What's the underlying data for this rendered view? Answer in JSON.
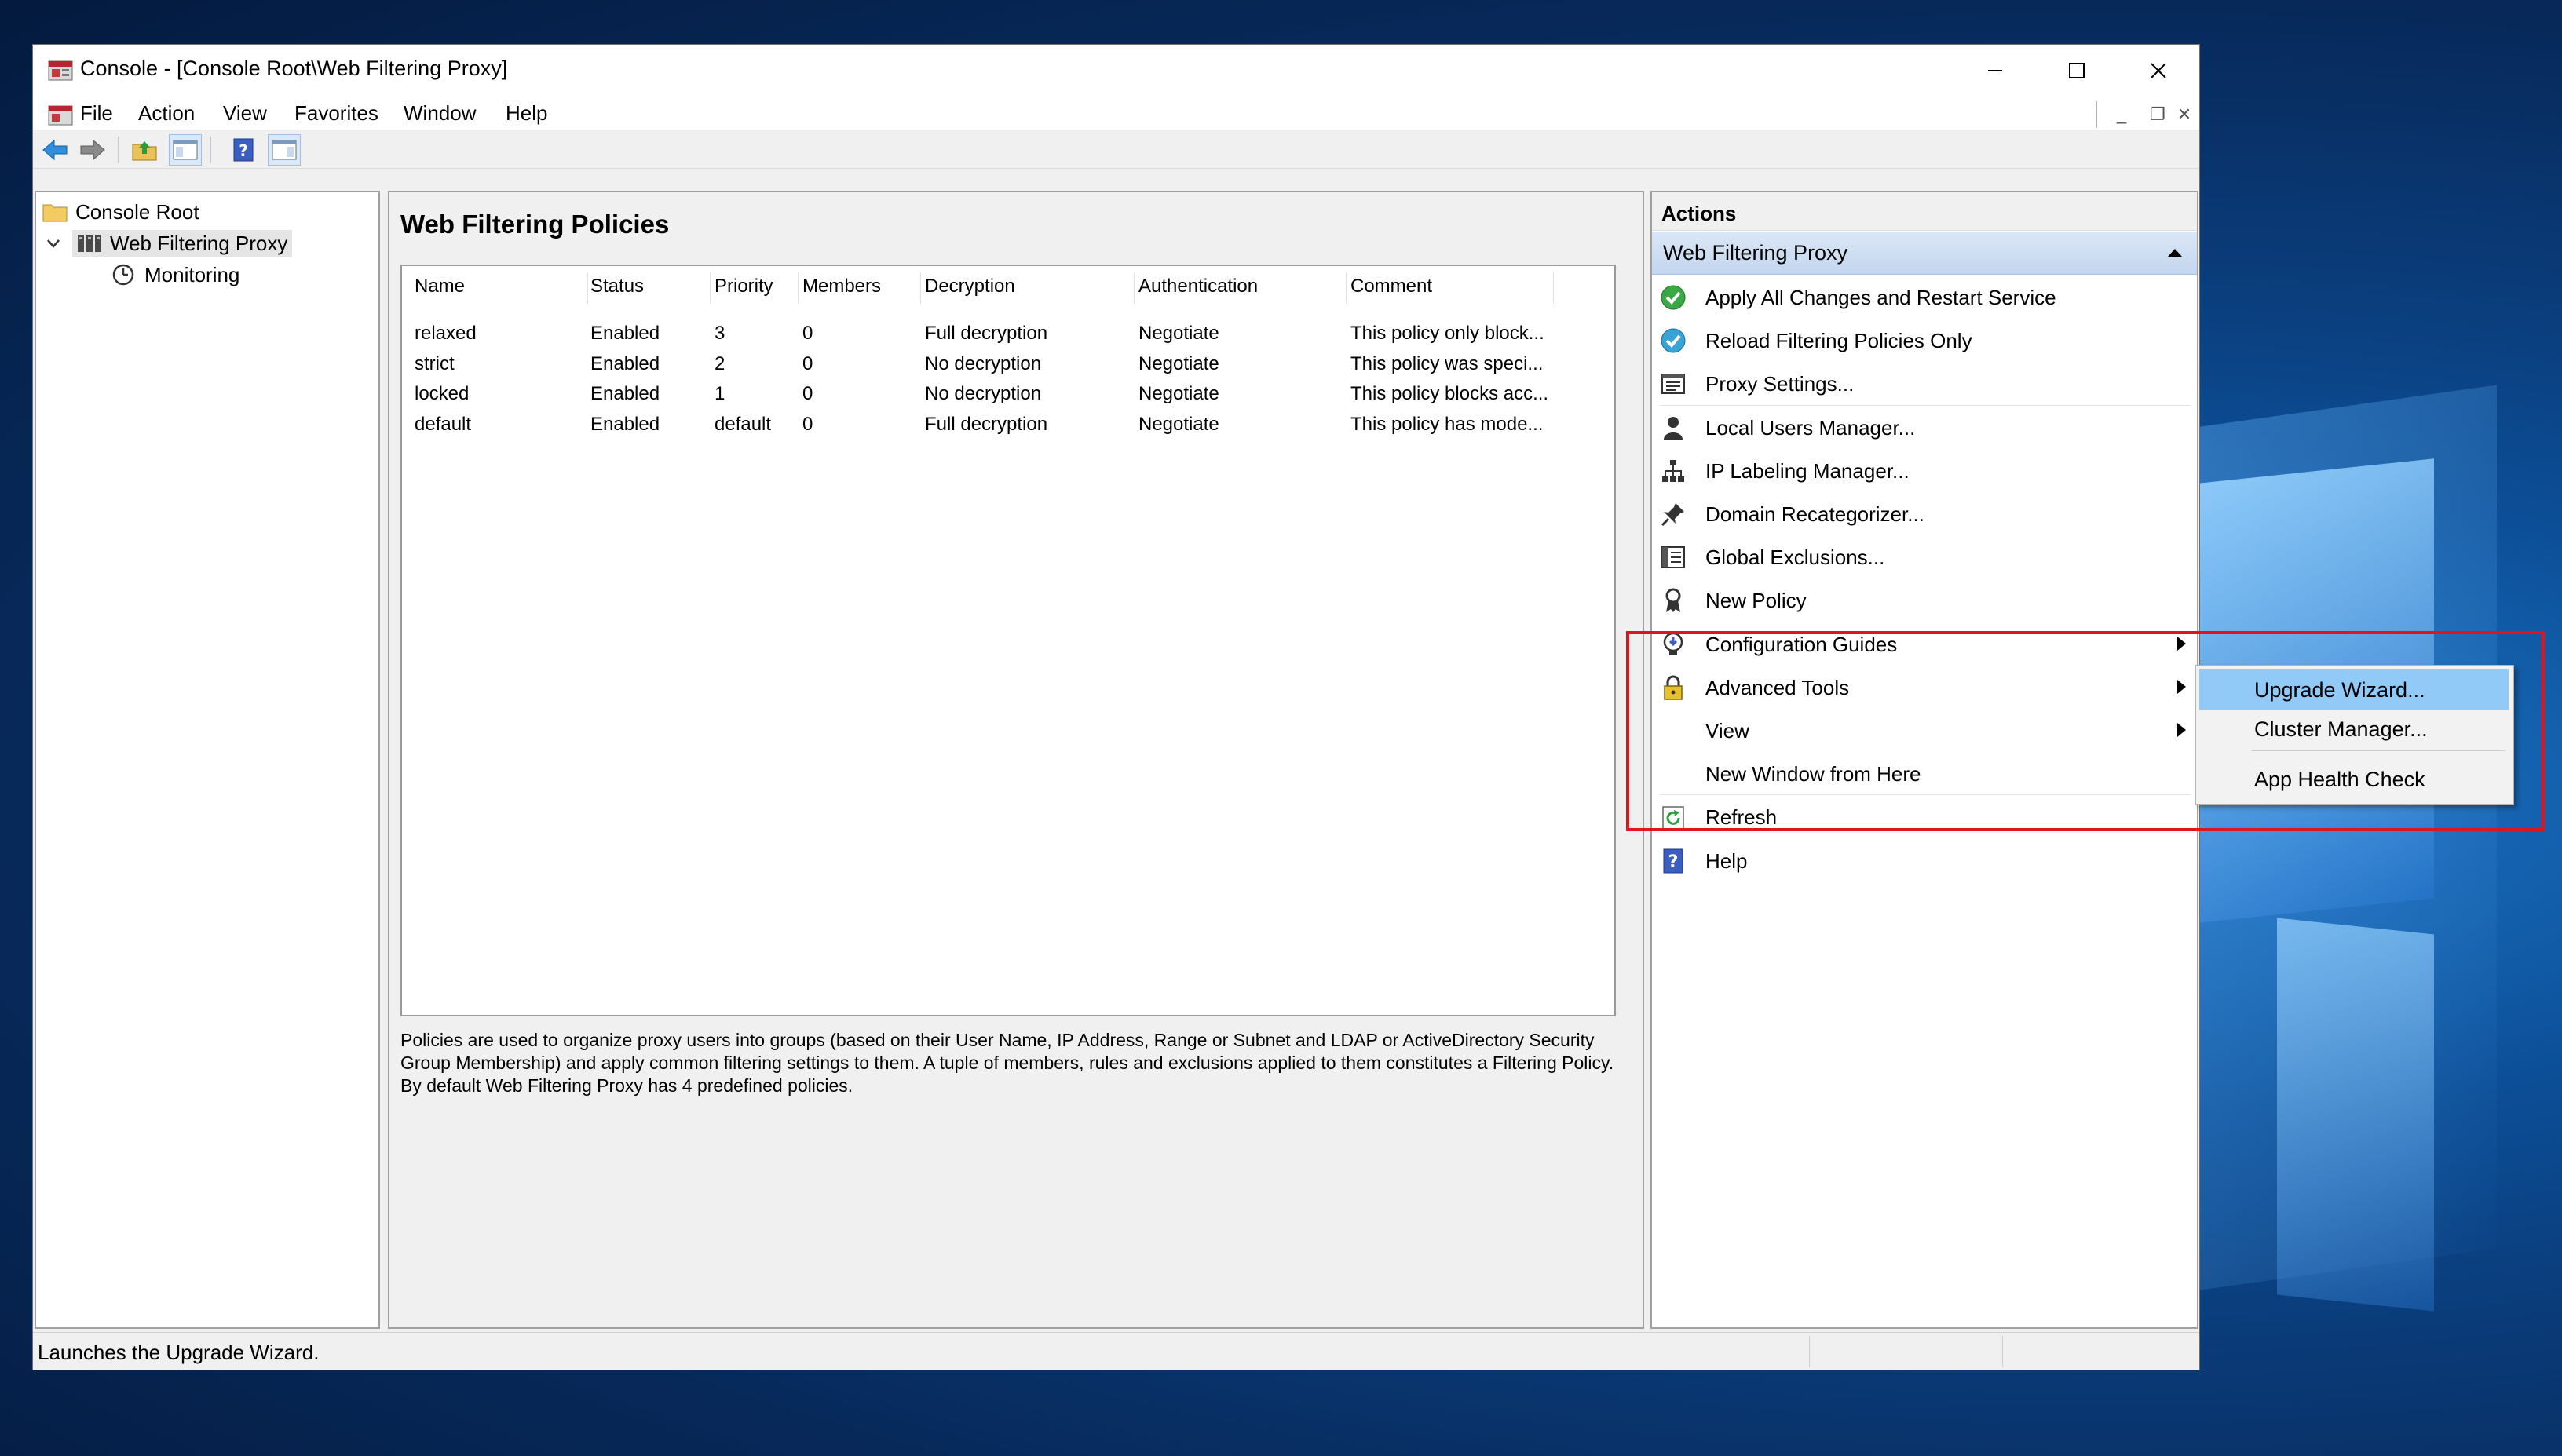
{
  "window": {
    "title": "Console - [Console Root\\Web Filtering Proxy]",
    "minimize_glyph": "—",
    "maximize_glyph": "☐",
    "close_glyph": "✕"
  },
  "menubar": {
    "items": [
      "File",
      "Action",
      "View",
      "Favorites",
      "Window",
      "Help"
    ],
    "mdi_minimize": "_",
    "mdi_restore": "❐",
    "mdi_close": "✕"
  },
  "toolbar": {
    "icons": [
      "back-arrow-icon",
      "forward-arrow-icon",
      "up-folder-icon",
      "show-hide-tree-icon",
      "help-icon",
      "show-hide-action-pane-icon"
    ]
  },
  "tree": {
    "root": "Console Root",
    "proxy": "Web Filtering Proxy",
    "monitoring": "Monitoring"
  },
  "center": {
    "title": "Web Filtering Policies",
    "columns": [
      "Name",
      "Status",
      "Priority",
      "Members",
      "Decryption",
      "Authentication",
      "Comment"
    ],
    "rows": [
      [
        "relaxed",
        "Enabled",
        "3",
        "0",
        "Full decryption",
        "Negotiate",
        "This policy only block..."
      ],
      [
        "strict",
        "Enabled",
        "2",
        "0",
        "No decryption",
        "Negotiate",
        "This policy was speci..."
      ],
      [
        "locked",
        "Enabled",
        "1",
        "0",
        "No decryption",
        "Negotiate",
        "This policy blocks acc..."
      ],
      [
        "default",
        "Enabled",
        "default",
        "0",
        "Full decryption",
        "Negotiate",
        "This policy has mode..."
      ]
    ],
    "description": "Policies are used to organize proxy users into groups (based on their User Name, IP Address, Range or Subnet and LDAP or ActiveDirectory Security Group Membership) and apply common filtering settings to them. A tuple of members, rules and exclusions applied to them constitutes a Filtering Policy. By default Web Filtering Proxy has 4 predefined policies."
  },
  "actions": {
    "header": "Actions",
    "group": "Web Filtering Proxy",
    "items": [
      {
        "label": "Apply All Changes and Restart Service",
        "icon": "green-check-icon"
      },
      {
        "label": "Reload Filtering Policies Only",
        "icon": "blue-check-icon"
      },
      {
        "label": "Proxy Settings...",
        "icon": "settings-list-icon"
      },
      {
        "label": "Local Users Manager...",
        "icon": "user-icon"
      },
      {
        "label": "IP Labeling Manager...",
        "icon": "network-tree-icon"
      },
      {
        "label": "Domain Recategorizer...",
        "icon": "pin-icon"
      },
      {
        "label": "Global Exclusions...",
        "icon": "exclusions-list-icon"
      },
      {
        "label": "New Policy",
        "icon": "ribbon-icon"
      },
      {
        "label": "Configuration Guides",
        "icon": "guide-bulb-icon"
      },
      {
        "label": "Advanced Tools",
        "icon": "lock-icon"
      },
      {
        "label": "View",
        "icon": ""
      },
      {
        "label": "New Window from Here",
        "icon": ""
      },
      {
        "label": "Refresh",
        "icon": "refresh-icon"
      },
      {
        "label": "Help",
        "icon": "help-icon"
      }
    ]
  },
  "submenu": {
    "items": [
      "Upgrade Wizard...",
      "Cluster Manager...",
      "App Health Check"
    ]
  },
  "status": {
    "text": "Launches the Upgrade Wizard."
  },
  "colors": {
    "highlight_box": "#e1141c",
    "submenu_selected": "#91c9f7",
    "group_header": "#c3d6ee"
  }
}
